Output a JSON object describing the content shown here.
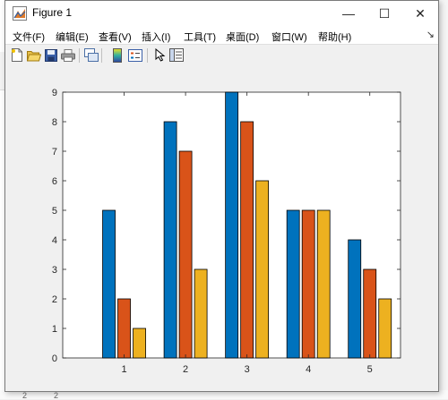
{
  "window": {
    "title": "Figure 1",
    "controls": {
      "minimize": "—",
      "maximize": "☐",
      "close": "✕"
    }
  },
  "menubar": {
    "items": [
      "文件(F)",
      "编辑(E)",
      "查看(V)",
      "插入(I)",
      "工具(T)",
      "桌面(D)",
      "窗口(W)",
      "帮助(H)"
    ],
    "overflow_arrow": "↘"
  },
  "toolbar": {
    "buttons": [
      "new-figure-icon",
      "open-file-icon",
      "save-icon",
      "print-icon",
      "link-plot-icon",
      "insert-colorbar-icon",
      "insert-legend-icon",
      "edit-plot-arrow-icon",
      "property-inspector-icon"
    ]
  },
  "background": {
    "ticks": [
      "2",
      "2"
    ]
  },
  "chart_data": {
    "type": "bar",
    "categories": [
      "1",
      "2",
      "3",
      "4",
      "5"
    ],
    "series": [
      {
        "values": [
          5,
          8,
          9,
          5,
          4
        ],
        "color": "#0072BD"
      },
      {
        "values": [
          2,
          7,
          8,
          5,
          3
        ],
        "color": "#D95319"
      },
      {
        "values": [
          1,
          3,
          6,
          5,
          2
        ],
        "color": "#EDB120"
      }
    ],
    "ylim": [
      0,
      9
    ],
    "yticks": [
      "0",
      "1",
      "2",
      "3",
      "4",
      "5",
      "6",
      "7",
      "8",
      "9"
    ],
    "xticks": [
      "1",
      "2",
      "3",
      "4",
      "5"
    ],
    "title": "",
    "xlabel": "",
    "ylabel": "",
    "grid": false
  }
}
